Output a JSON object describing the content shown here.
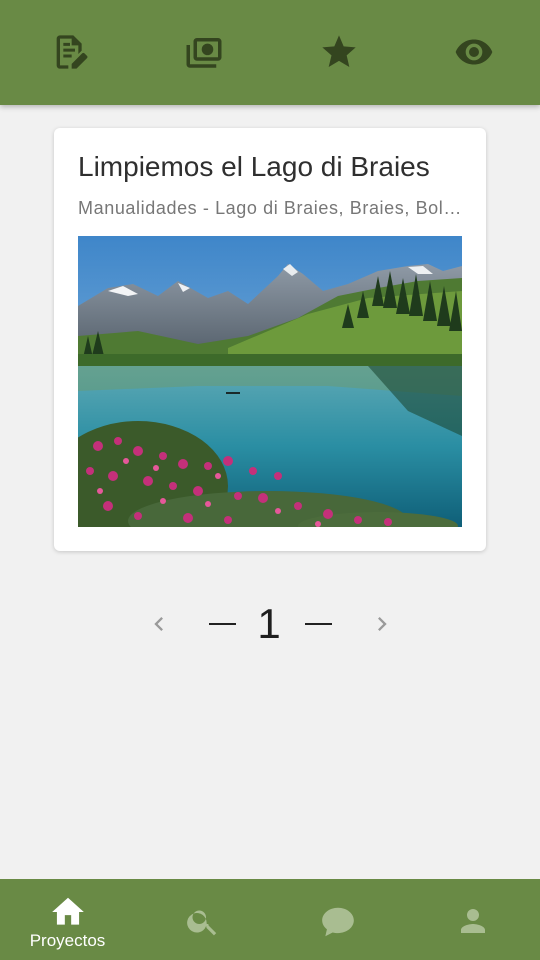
{
  "top_tabs": [
    {
      "icon": "edit-note-icon"
    },
    {
      "icon": "money-icon"
    },
    {
      "icon": "star-icon"
    },
    {
      "icon": "eye-icon"
    }
  ],
  "card": {
    "title": "Limpiemos el Lago di Braies",
    "subtitle": "Manualidades - Lago di Braies, Braies, Bolzano",
    "image": "mountain-lake-photo"
  },
  "pagination": {
    "current_page": "1",
    "prev_icon": "chevron-left-icon",
    "next_icon": "chevron-right-icon"
  },
  "bottom_nav": {
    "items": [
      {
        "icon": "home-icon",
        "label": "Proyectos",
        "active": true
      },
      {
        "icon": "search-icon"
      },
      {
        "icon": "chat-icon"
      },
      {
        "icon": "person-icon"
      }
    ]
  },
  "colors": {
    "bar_green": "#698a45",
    "top_icon": "#34451f",
    "inactive_nav_icon": "#a9bd91",
    "background": "#f1f1f1"
  }
}
